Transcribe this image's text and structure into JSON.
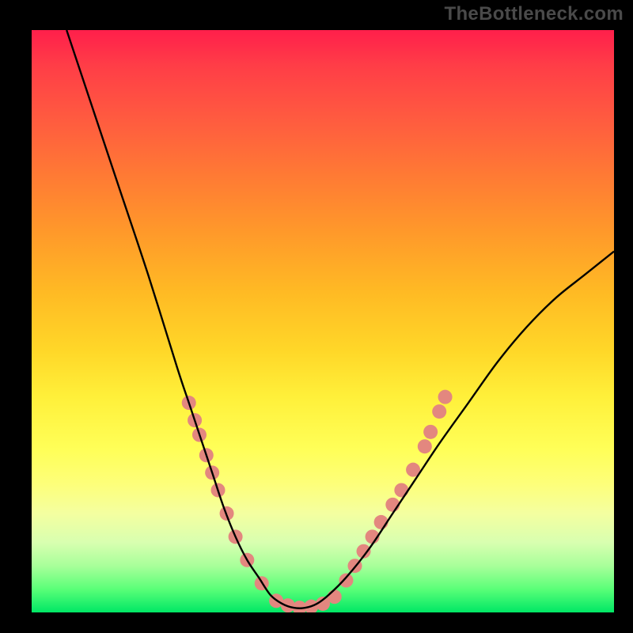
{
  "watermark": {
    "text": "TheBottleneck.com"
  },
  "chart_data": {
    "type": "line",
    "title": "",
    "xlabel": "",
    "ylabel": "",
    "xlim": [
      0,
      100
    ],
    "ylim": [
      0,
      100
    ],
    "grid": false,
    "legend": false,
    "background_gradient": {
      "direction": "vertical",
      "stops": [
        {
          "pos": 0,
          "color": "#ff1f4b"
        },
        {
          "pos": 25,
          "color": "#ff7a34"
        },
        {
          "pos": 55,
          "color": "#ffd728"
        },
        {
          "pos": 78,
          "color": "#fdff7a"
        },
        {
          "pos": 100,
          "color": "#00e765"
        }
      ]
    },
    "series": [
      {
        "name": "bottleneck-curve",
        "stroke": "#000000",
        "x": [
          6,
          10,
          15,
          20,
          25,
          27,
          29,
          31,
          33,
          35,
          37,
          39,
          41,
          43,
          45,
          47,
          49,
          51,
          54,
          58,
          62,
          66,
          70,
          75,
          80,
          85,
          90,
          95,
          100
        ],
        "y": [
          100,
          88,
          73,
          58,
          42,
          36,
          30,
          24,
          18,
          13,
          9,
          6,
          3,
          1.5,
          0.8,
          0.8,
          1.5,
          3,
          6,
          11,
          17,
          23,
          29,
          36,
          43,
          49,
          54,
          58,
          62
        ]
      }
    ],
    "scatter": [
      {
        "name": "left-arm-dots",
        "color": "#e3877f",
        "radius": 9,
        "points": [
          {
            "x": 27.0,
            "y": 36.0
          },
          {
            "x": 28.0,
            "y": 33.0
          },
          {
            "x": 28.8,
            "y": 30.5
          },
          {
            "x": 30.0,
            "y": 27.0
          },
          {
            "x": 31.0,
            "y": 24.0
          },
          {
            "x": 32.0,
            "y": 21.0
          },
          {
            "x": 33.5,
            "y": 17.0
          },
          {
            "x": 35.0,
            "y": 13.0
          },
          {
            "x": 37.0,
            "y": 9.0
          },
          {
            "x": 39.5,
            "y": 5.0
          }
        ]
      },
      {
        "name": "bottom-dots",
        "color": "#e3877f",
        "radius": 9,
        "points": [
          {
            "x": 42.0,
            "y": 2.0
          },
          {
            "x": 44.0,
            "y": 1.2
          },
          {
            "x": 46.0,
            "y": 0.8
          },
          {
            "x": 48.0,
            "y": 1.0
          },
          {
            "x": 50.0,
            "y": 1.5
          },
          {
            "x": 52.0,
            "y": 2.7
          }
        ]
      },
      {
        "name": "right-arm-dots",
        "color": "#e3877f",
        "radius": 9,
        "points": [
          {
            "x": 54.0,
            "y": 5.5
          },
          {
            "x": 55.5,
            "y": 8.0
          },
          {
            "x": 57.0,
            "y": 10.5
          },
          {
            "x": 58.5,
            "y": 13.0
          },
          {
            "x": 60.0,
            "y": 15.5
          },
          {
            "x": 62.0,
            "y": 18.5
          },
          {
            "x": 63.5,
            "y": 21.0
          },
          {
            "x": 65.5,
            "y": 24.5
          },
          {
            "x": 67.5,
            "y": 28.5
          },
          {
            "x": 68.5,
            "y": 31.0
          },
          {
            "x": 70.0,
            "y": 34.5
          },
          {
            "x": 71.0,
            "y": 37.0
          }
        ]
      }
    ]
  }
}
